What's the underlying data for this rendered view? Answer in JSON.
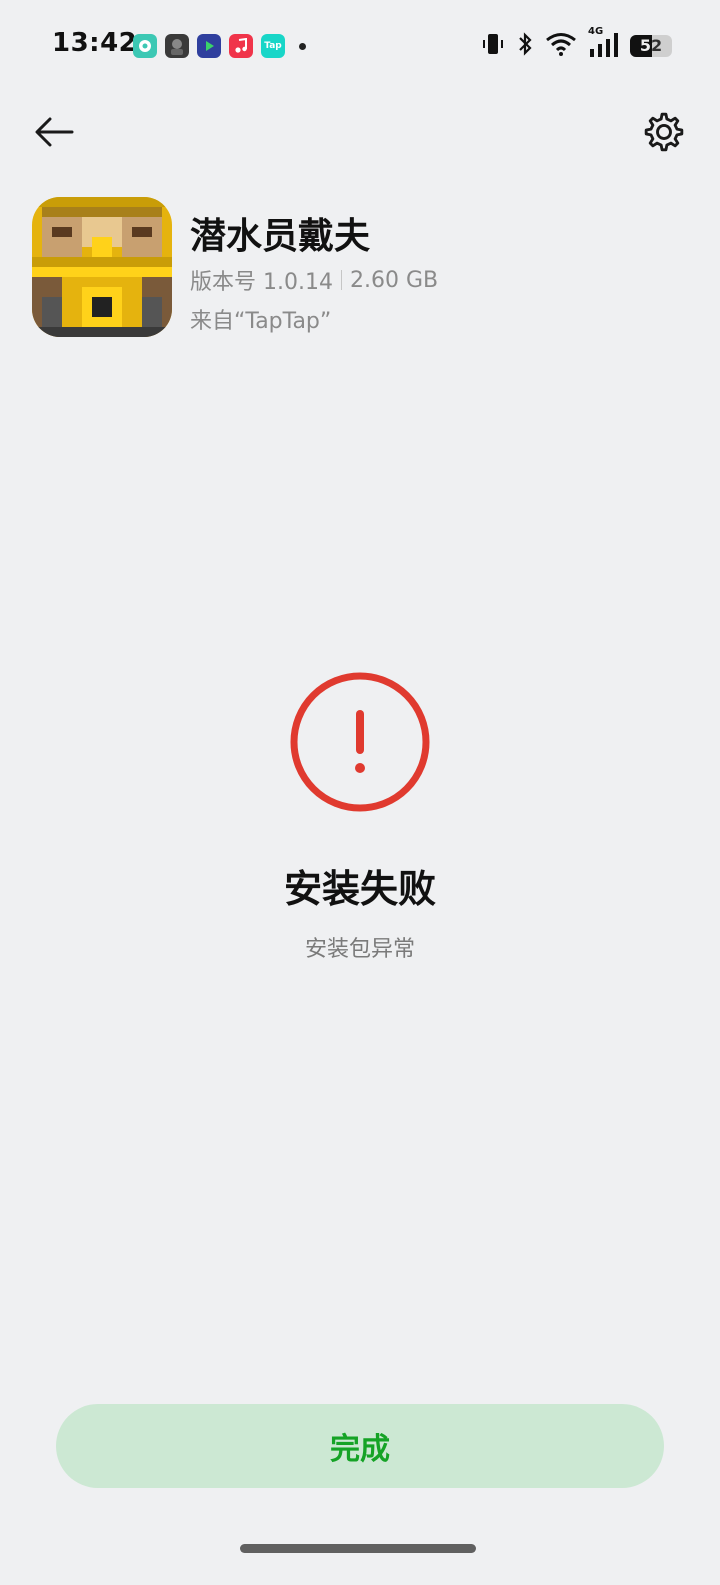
{
  "status_bar": {
    "time": "13:42",
    "notification_icons": [
      "chat-app-icon",
      "game-avatar-icon",
      "video-app-icon",
      "music-app-icon",
      "taptap-icon"
    ],
    "taptap_label": "Tap",
    "network_label": "4G",
    "battery_level": "52"
  },
  "nav": {
    "back_icon": "arrow-left-icon",
    "settings_icon": "gear-icon"
  },
  "app": {
    "name": "潜水员戴夫",
    "version": "版本号 1.0.14",
    "size": "2.60 GB",
    "source": "来自“TapTap”"
  },
  "result": {
    "icon": "error-circle-icon",
    "title": "安装失败",
    "subtitle": "安装包异常",
    "error_color": "#e03a2f"
  },
  "actions": {
    "done_label": "完成",
    "accent_color": "#15a326"
  }
}
